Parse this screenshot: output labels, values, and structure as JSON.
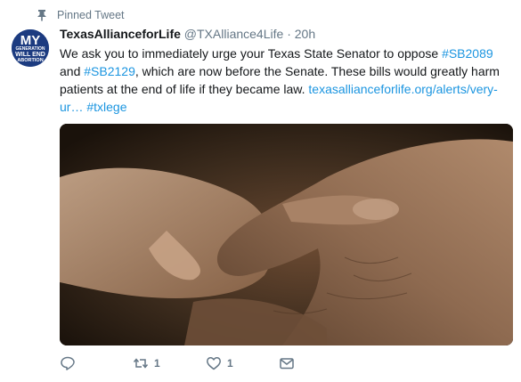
{
  "pinned_label": "Pinned Tweet",
  "author": {
    "display_name": "TexasAllianceforLife",
    "handle": "@TXAlliance4Life",
    "separator": "·",
    "time": "20h",
    "avatar_text": [
      "MY",
      "GENERATION",
      "WILL END",
      "ABORTION"
    ]
  },
  "tweet": {
    "text_1": "We ask you to immediately urge your Texas State Senator to oppose ",
    "hashtag_1": "#SB2089",
    "text_2": " and ",
    "hashtag_2": "#SB2129",
    "text_3": ", which are now before the Senate. These bills would greatly harm patients at the end of life if they became law.  ",
    "link": "texasallianceforlife.org/alerts/very-ur…",
    "text_4": " ",
    "hashtag_3": "#txlege"
  },
  "media": {
    "description": "hands-photo"
  },
  "actions": {
    "reply_icon": "reply-icon",
    "retweet_icon": "retweet-icon",
    "retweet_count": "1",
    "like_icon": "heart-icon",
    "like_count": "1",
    "message_icon": "envelope-icon"
  },
  "colors": {
    "link": "#1b95e0",
    "meta": "#657786",
    "avatar_bg": "#1c3b80"
  }
}
